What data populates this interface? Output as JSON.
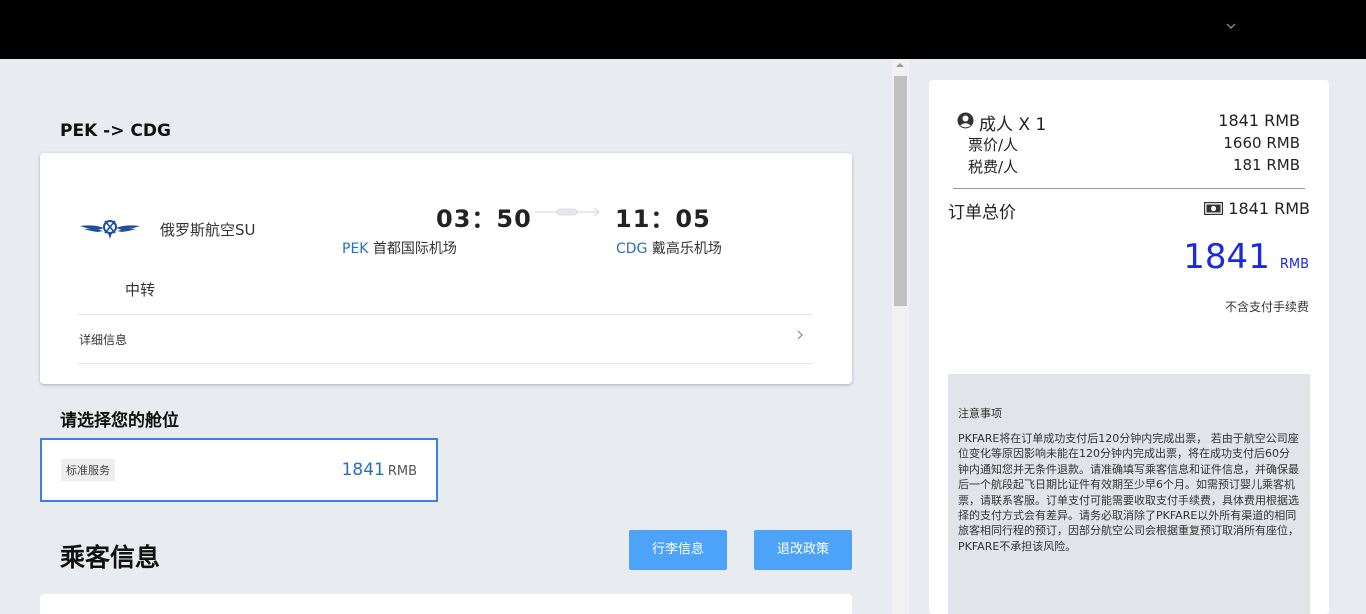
{
  "topbar": {
    "menu_icon": "chevron-down-icon"
  },
  "flight": {
    "route": "PEK -> CDG",
    "airline": "俄罗斯航空SU",
    "airline_logo": "aeroflot-logo",
    "departure_time": "03：50",
    "arrival_time": "11：05",
    "departure_code": "PEK",
    "departure_airport": "首都国际机场",
    "arrival_code": "CDG",
    "arrival_airport": "戴高乐机场",
    "stop_type": "中转",
    "detail_label": "详细信息"
  },
  "cabin": {
    "title": "请选择您的舱位",
    "options": [
      {
        "tag": "标准服务",
        "price": "1841",
        "unit": "RMB",
        "selected": true
      }
    ]
  },
  "passengers": {
    "title": "乘客信息",
    "baggage_button": "行李信息",
    "refund_button": "退改政策"
  },
  "price_summary": {
    "adult_label": "成人 X 1",
    "adult_total": "1841 RMB",
    "fare_label": "票价/人",
    "fare_value": "1660 RMB",
    "tax_label": "税费/人",
    "tax_value": "181 RMB",
    "order_total_label": "订单总价",
    "order_total_value": "1841 RMB",
    "big_total": "1841",
    "big_total_unit": "RMB",
    "fee_note": "不含支付手续费"
  },
  "notice": {
    "title": "注意事项",
    "body": "PKFARE将在订单成功支付后120分钟内完成出票， 若由于航空公司座位变化等原因影响未能在120分钟内完成出票，将在成功支付后60分钟内通知您并无条件退款。请准确填写乘客信息和证件信息，并确保最后一个航段起飞日期比证件有效期至少早6个月。如需预订婴儿乘客机票，请联系客服。订单支付可能需要收取支付手续费，具体费用根据选择的支付方式会有差异。请务必取消除了PKFARE以外所有渠道的相同旅客相同行程的预订，因部分航空公司会根据重复预订取消所有座位，PKFARE不承担该风险。"
  },
  "colors": {
    "accent_blue": "#2a6fb8",
    "button_blue": "#4da3f8",
    "total_blue": "#1a2bdc",
    "selected_border": "#3b82e0"
  }
}
